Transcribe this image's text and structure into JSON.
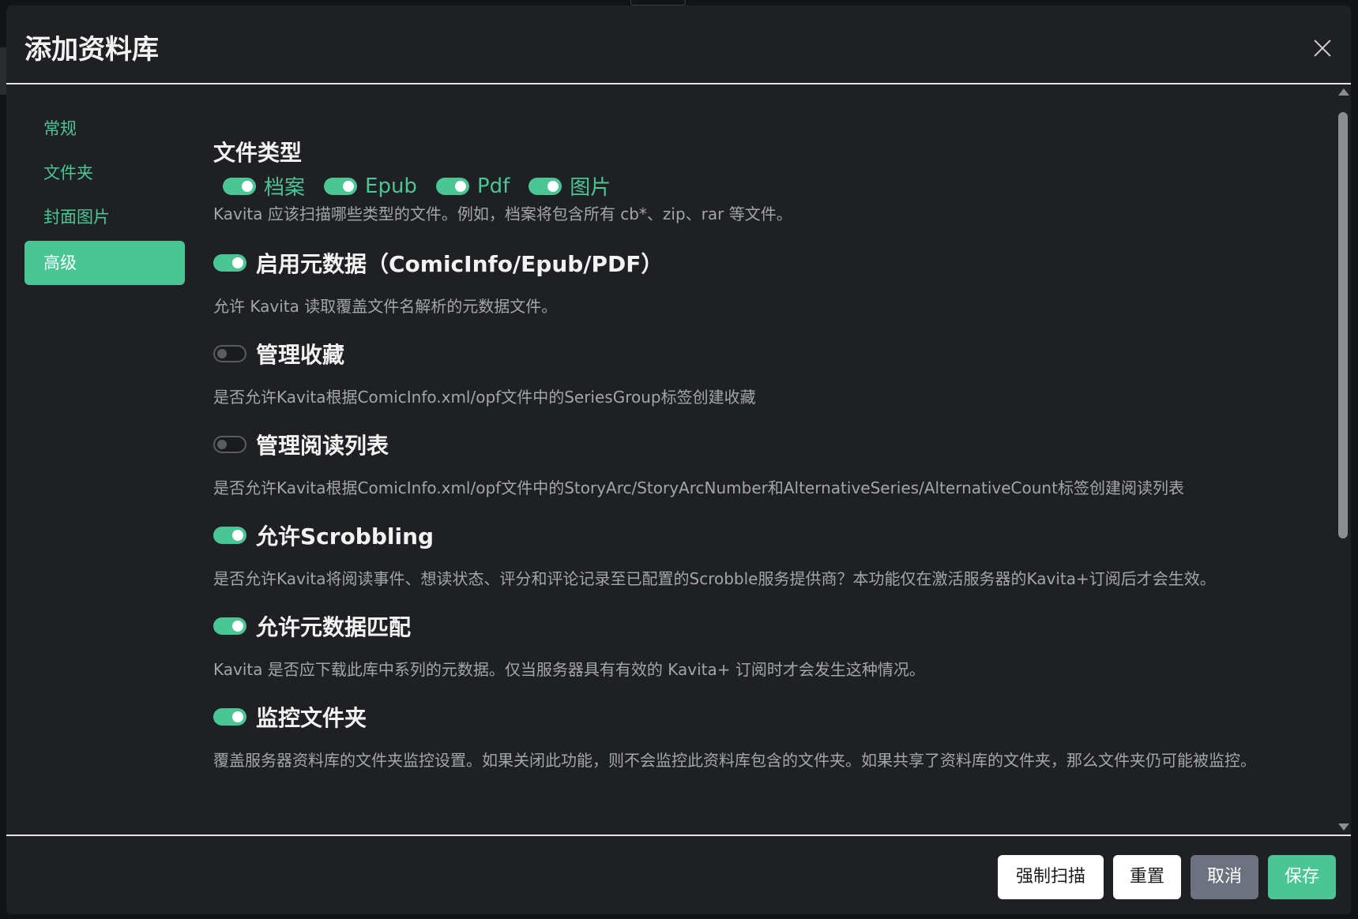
{
  "modal": {
    "title": "添加资料库"
  },
  "sidebar": {
    "items": [
      {
        "label": "常规"
      },
      {
        "label": "文件夹"
      },
      {
        "label": "封面图片"
      },
      {
        "label": "高级"
      }
    ]
  },
  "file_types": {
    "title": "文件类型",
    "items": [
      {
        "label": "档案",
        "enabled": true
      },
      {
        "label": "Epub",
        "enabled": true
      },
      {
        "label": "Pdf",
        "enabled": true
      },
      {
        "label": "图片",
        "enabled": true
      }
    ],
    "help": "Kavita 应该扫描哪些类型的文件。例如，档案将包含所有 cb*、zip、rar 等文件。"
  },
  "settings": [
    {
      "label": "启用元数据（ComicInfo/Epub/PDF）",
      "enabled": true,
      "help": "允许 Kavita 读取覆盖文件名解析的元数据文件。"
    },
    {
      "label": "管理收藏",
      "enabled": false,
      "help": "是否允许Kavita根据ComicInfo.xml/opf文件中的SeriesGroup标签创建收藏"
    },
    {
      "label": "管理阅读列表",
      "enabled": false,
      "help": "是否允许Kavita根据ComicInfo.xml/opf文件中的StoryArc/StoryArcNumber和AlternativeSeries/AlternativeCount标签创建阅读列表"
    },
    {
      "label": "允许Scrobbling",
      "enabled": true,
      "help": "是否允许Kavita将阅读事件、想读状态、评分和评论记录至已配置的Scrobble服务提供商？本功能仅在激活服务器的Kavita+订阅后才会生效。"
    },
    {
      "label": "允许元数据匹配",
      "enabled": true,
      "help": "Kavita 是否应下载此库中系列的元数据。仅当服务器具有有效的 Kavita+ 订阅时才会发生这种情况。"
    },
    {
      "label": "监控文件夹",
      "enabled": true,
      "help": "覆盖服务器资料库的文件夹监控设置。如果关闭此功能，则不会监控此资料库包含的文件夹。如果共享了资料库的文件夹，那么文件夹仍可能被监控。"
    }
  ],
  "footer": {
    "force_scan": "强制扫描",
    "reset": "重置",
    "cancel": "取消",
    "save": "保存"
  },
  "colors": {
    "accent": "#4ac694",
    "modal_bg": "#1f2023",
    "cancel_btn": "#6c737e"
  }
}
